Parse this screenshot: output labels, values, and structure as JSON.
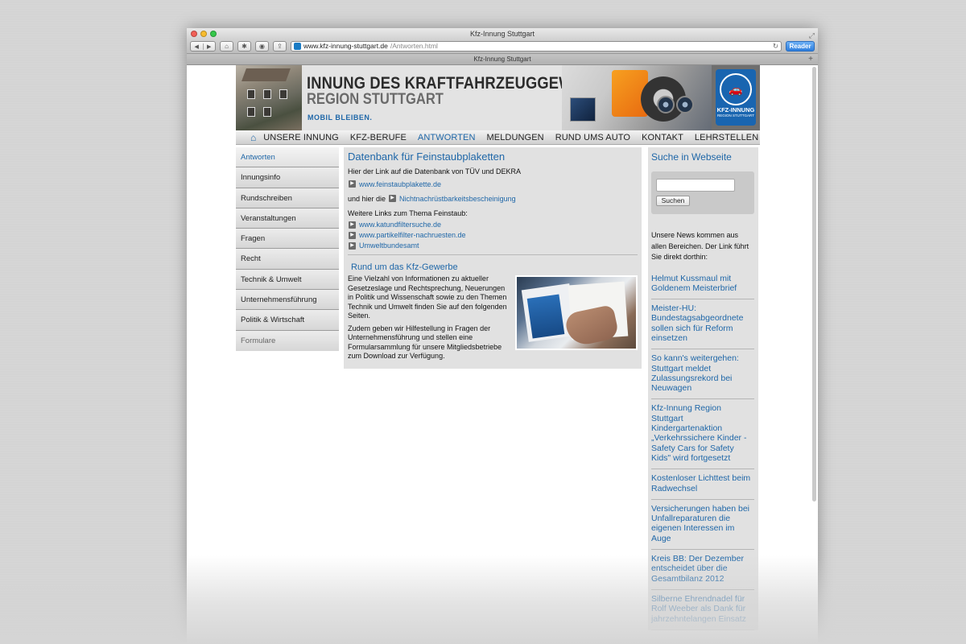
{
  "browser": {
    "window_title": "Kfz-Innung Stuttgart",
    "url_domain": "www.kfz-innung-stuttgart.de",
    "url_path": "/Antworten.html",
    "reader_label": "Reader",
    "tab_title": "Kfz-Innung Stuttgart",
    "new_tab_label": "+"
  },
  "header": {
    "title": "INNUNG DES KRAFTFAHRZEUGGEWERBES",
    "subtitle": "REGION STUTTGART",
    "slogan": "MOBIL BLEIBEN.",
    "logo_name": "KFZ-INNUNG",
    "logo_sub": "REGION STUTTGART"
  },
  "nav": {
    "items": [
      {
        "label": "UNSERE INNUNG"
      },
      {
        "label": "KFZ-BERUFE"
      },
      {
        "label": "ANTWORTEN"
      },
      {
        "label": "MELDUNGEN"
      },
      {
        "label": "RUND UMS AUTO"
      },
      {
        "label": "KONTAKT"
      },
      {
        "label": "LEHRSTELLEN"
      }
    ],
    "active": "ANTWORTEN"
  },
  "sidebar": {
    "items": [
      {
        "label": "Antworten"
      },
      {
        "label": "Innungsinfo"
      },
      {
        "label": "Rundschreiben"
      },
      {
        "label": "Veranstaltungen"
      },
      {
        "label": "Fragen"
      },
      {
        "label": "Recht"
      },
      {
        "label": "Technik & Umwelt"
      },
      {
        "label": "Unternehmensführung"
      },
      {
        "label": "Politik & Wirtschaft"
      },
      {
        "label": "Formulare"
      }
    ]
  },
  "main": {
    "heading": "Datenbank für Feinstaubplaketten",
    "intro": "Hier der Link auf die Datenbank von TÜV und DEKRA",
    "link1": "www.feinstaubplakette.de",
    "and_here": "und hier die",
    "link2": "Nichtnachrüstbarkeitsbescheinigung",
    "more_links_label": "Weitere Links zum Thema Feinstaub:",
    "more_links": [
      {
        "label": "www.katundfiltersuche.de"
      },
      {
        "label": "www.partikelfilter-nachruesten.de"
      },
      {
        "label": "Umweltbundesamt"
      }
    ],
    "section_heading": "Rund um das Kfz-Gewerbe",
    "para1": "Eine Vielzahl von Informationen zu aktueller Gesetzeslage und Rechtsprechung, Neuerungen in Politik und Wissenschaft sowie zu den Themen Technik und Umwelt finden Sie auf den folgenden Seiten.",
    "para2": "Zudem geben wir Hilfestellung in Fragen der Unternehmensführung und stellen eine Formularsammlung für unsere Mitgliedsbetriebe zum Download zur Verfügung."
  },
  "right": {
    "search_heading": "Suche in Webseite",
    "search_button": "Suchen",
    "news_intro": "Unsere News kommen aus allen Bereichen. Der Link führt Sie direkt dorthin:",
    "news": [
      {
        "title": "Helmut Kussmaul mit Goldenem Meisterbrief"
      },
      {
        "title": "Meister-HU: Bundestagsabgeordnete sollen sich für Reform einsetzen"
      },
      {
        "title": "So kann's weitergehen: Stuttgart meldet Zulassungsrekord bei Neuwagen"
      },
      {
        "title": "Kfz-Innung Region Stuttgart Kindergartenaktion „Verkehrssichere Kinder - Safety Cars for Safety Kids\" wird fortgesetzt"
      },
      {
        "title": "Kostenloser Lichttest beim Radwechsel"
      },
      {
        "title": "Versicherungen haben bei Unfallreparaturen die eigenen Interessen im Auge"
      },
      {
        "title": "Kreis BB: Der Dezember entscheidet über die Gesamtbilanz 2012"
      },
      {
        "title": "Silberne Ehrendnadel für Rolf Weeber als Dank für jahrzehntelangen Einsatz"
      }
    ]
  },
  "colors": {
    "accent": "#1f67a8",
    "panel": "#e1e1e1"
  }
}
